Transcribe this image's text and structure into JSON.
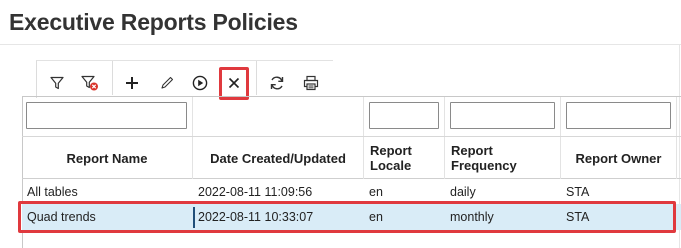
{
  "page": {
    "title": "Executive Reports Policies"
  },
  "toolbar": {
    "buttons": [
      {
        "name": "filter-icon"
      },
      {
        "name": "clear-filter-icon"
      },
      {
        "name": "add-icon"
      },
      {
        "name": "edit-icon"
      },
      {
        "name": "run-icon"
      },
      {
        "name": "close-icon"
      },
      {
        "name": "refresh-icon"
      },
      {
        "name": "print-icon"
      }
    ]
  },
  "columns": [
    {
      "label": "Report Name"
    },
    {
      "label": "Date Created/Updated"
    },
    {
      "label": "Report\nLocale"
    },
    {
      "label": "Report\nFrequency"
    },
    {
      "label": "Report Owner"
    }
  ],
  "filters": [
    {
      "value": ""
    },
    {
      "value": ""
    },
    {
      "value": ""
    },
    {
      "value": ""
    }
  ],
  "rows": [
    {
      "name": "All tables",
      "date": "2022-08-11 11:09:56",
      "locale": "en",
      "frequency": "daily",
      "owner": "STA"
    },
    {
      "name": "Quad trends",
      "date": "2022-08-11 10:33:07",
      "locale": "en",
      "frequency": "monthly",
      "owner": "STA"
    }
  ],
  "colors": {
    "highlight": "#e0393e",
    "selected_row": "#d9ecf7"
  }
}
